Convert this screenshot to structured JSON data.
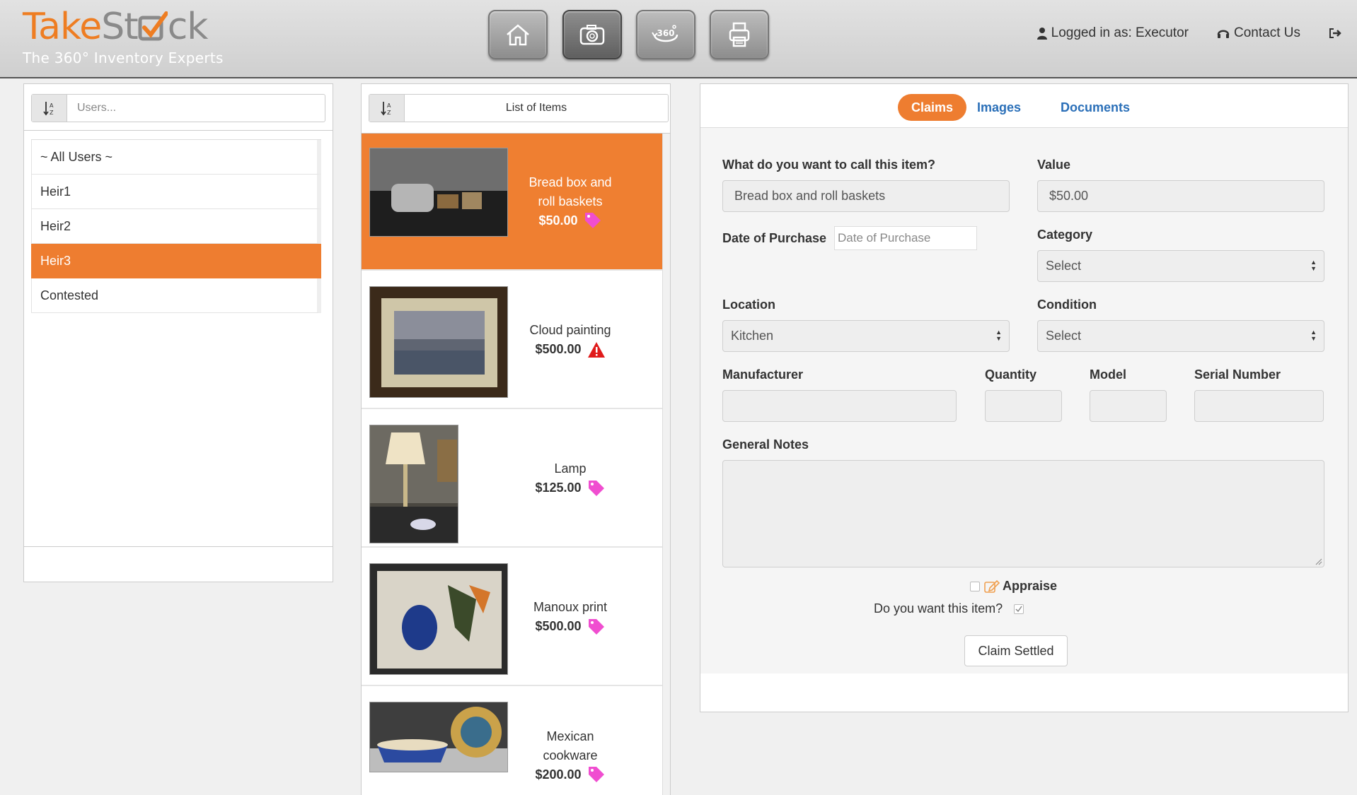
{
  "brand": {
    "name_part1": "Take",
    "name_part2": "St",
    "name_part3": "ck",
    "tagline": "The 360° Inventory Experts",
    "accent": "#ee7d30"
  },
  "toolbar": {
    "buttons": [
      {
        "icon": "home-icon"
      },
      {
        "icon": "camera-icon"
      },
      {
        "icon": "360-view-icon",
        "label": "360"
      },
      {
        "icon": "printer-icon"
      }
    ]
  },
  "header": {
    "logged_in": "Logged in as: Executor",
    "contact": "Contact Us"
  },
  "users": {
    "sort_label": "A-Z",
    "search_placeholder": "Users...",
    "items": [
      {
        "label": "~ All Users ~"
      },
      {
        "label": "Heir1"
      },
      {
        "label": "Heir2"
      },
      {
        "label": "Heir3",
        "selected": true
      },
      {
        "label": "Contested"
      }
    ]
  },
  "items": {
    "title": "List of Items",
    "list": [
      {
        "name_line1": "Bread box and",
        "name_line2": "roll baskets",
        "price": "$50.00",
        "status_icon": "tag-icon",
        "selected": true
      },
      {
        "name_line1": "Cloud painting",
        "name_line2": "",
        "price": "$500.00",
        "status_icon": "warning-icon"
      },
      {
        "name_line1": "Lamp",
        "name_line2": "",
        "price": "$125.00",
        "status_icon": "tag-icon"
      },
      {
        "name_line1": "Manoux print",
        "name_line2": "",
        "price": "$500.00",
        "status_icon": "tag-icon"
      },
      {
        "name_line1": "Mexican",
        "name_line2": "cookware",
        "price": "$200.00",
        "status_icon": "tag-icon"
      }
    ]
  },
  "detail": {
    "tabs": [
      "Claims",
      "Images",
      "Documents"
    ],
    "active_tab": "Claims",
    "fields": {
      "name_label": "What do you want to call this item?",
      "name_value": "Bread box and roll baskets",
      "value_label": "Value",
      "value_value": "$50.00",
      "date_label": "Date of Purchase",
      "date_placeholder": "Date of Purchase",
      "category_label": "Category",
      "category_value": "Select",
      "location_label": "Location",
      "location_value": "Kitchen",
      "condition_label": "Condition",
      "condition_value": "Select",
      "manufacturer_label": "Manufacturer",
      "quantity_label": "Quantity",
      "model_label": "Model",
      "serial_label": "Serial Number",
      "notes_label": "General Notes"
    },
    "appraise_label": "Appraise",
    "want_label": "Do you want this item?",
    "claim_button": "Claim Settled"
  }
}
